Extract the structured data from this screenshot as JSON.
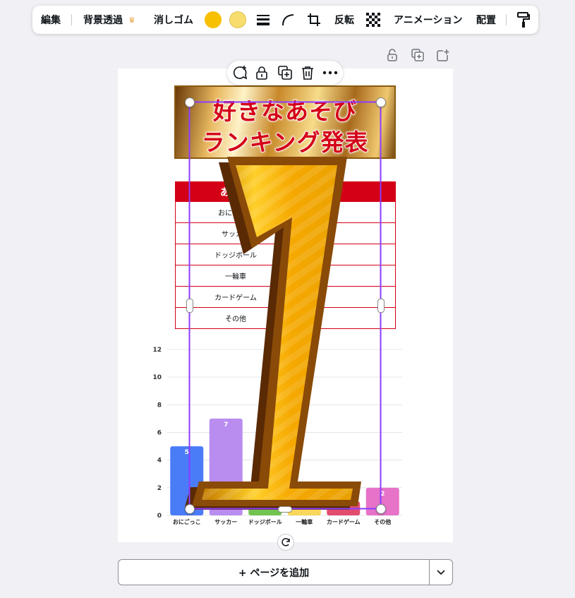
{
  "toolbar": {
    "edit": "編集",
    "bg_remove": "背景透過",
    "eraser": "消しゴム",
    "flip": "反転",
    "animate": "アニメーション",
    "position": "配置",
    "color_1": "#f7c000",
    "color_2": "#f6dd6e"
  },
  "page_tools": [
    "lock-icon",
    "duplicate-page-icon",
    "add-page-icon"
  ],
  "element_toolbar": [
    "comment-add-icon",
    "lock-icon",
    "duplicate-icon",
    "trash-icon",
    "more-icon"
  ],
  "page": {
    "banner": {
      "line1": "好きなあそび",
      "line2": "ランキング発表"
    },
    "table": {
      "header": "あそび",
      "rows": [
        "おにごっこ",
        "サッカー",
        "ドッジボール",
        "一輪車",
        "カードゲーム",
        "その他"
      ]
    }
  },
  "chart_data": {
    "type": "bar",
    "categories": [
      "おにごっこ",
      "サッカー",
      "ドッジボール",
      "一輪車",
      "カードゲーム",
      "その他"
    ],
    "values": [
      5,
      7,
      1,
      1,
      1,
      2
    ],
    "data_labels": [
      "5",
      "7",
      "",
      "",
      "",
      "2"
    ],
    "colors": [
      "#4a7cf7",
      "#b98df0",
      "#72c450",
      "#f8d75a",
      "#e24c6f",
      "#e773c8"
    ],
    "ylim": [
      0,
      12
    ],
    "yticks": [
      "0",
      "2",
      "4",
      "6",
      "8",
      "10",
      "12"
    ],
    "grid": true
  },
  "add_page": {
    "label": "+ ページを追加"
  }
}
